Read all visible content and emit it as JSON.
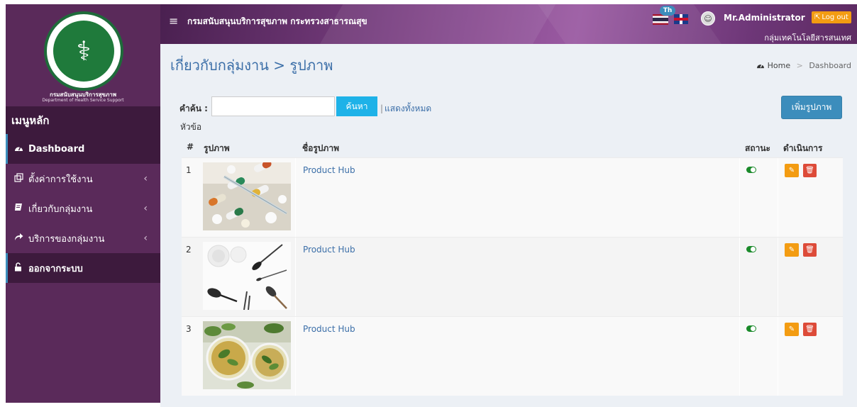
{
  "sidebar": {
    "logo_text": "⚕",
    "logo_caption_1": "กรมสนับสนุนบริการสุขภาพ",
    "logo_caption_2": "Department of Health Service Support",
    "menu_header": "เมนูหลัก",
    "items": [
      {
        "label": "Dashboard",
        "icon": "dashboard-icon"
      },
      {
        "label": "ตั้งค่าการใช้งาน",
        "icon": "clone-icon"
      },
      {
        "label": "เกี่ยวกับกลุ่มงาน",
        "icon": "book-icon"
      },
      {
        "label": "บริการของกลุ่มงาน",
        "icon": "share-arrow-icon"
      },
      {
        "label": "ออกจากระบบ",
        "icon": "lock-icon"
      }
    ]
  },
  "header": {
    "site_title": "กรมสนับสนุนบริการสุขภาพ กระทรวงสาธารณสุข",
    "lang_badge": "Th",
    "user_name": "Mr.Administrator",
    "logout_label": "Log out",
    "dept_name": "กลุ่มเทคโนโลยีสารสนเทศ"
  },
  "page": {
    "title": "เกี่ยวกับกลุ่มงาน > รูปภาพ",
    "breadcrumb_home": "Home",
    "breadcrumb_sep": ">",
    "breadcrumb_current": "Dashboard"
  },
  "search": {
    "label": "คำค้น :",
    "value": "",
    "placeholder": "",
    "button": "ค้นหา",
    "show_all_sep": "|",
    "show_all": "แสดงทั้งหมด",
    "topic_label": "หัวข้อ"
  },
  "add_button": "เพิ่มรูปภาพ",
  "table": {
    "headers": {
      "num": "#",
      "image": "รูปภาพ",
      "name": "ชื่อรูปภาพ",
      "status": "สถานะ",
      "action": "ดำเนินการ"
    },
    "rows": [
      {
        "num": "1",
        "name": "Product Hub",
        "image": "pills-photo"
      },
      {
        "num": "2",
        "name": "Product Hub",
        "image": "makeup-brushes-photo"
      },
      {
        "num": "3",
        "name": "Product Hub",
        "image": "herbal-tea-photo"
      }
    ]
  },
  "colors": {
    "sidebar": "#5a2a5a",
    "sidebar_active": "#3d1a3d",
    "accent_blue": "#3c8dbc",
    "search_btn": "#1eb2e8",
    "edit": "#f39c12",
    "delete": "#dd4b39",
    "status_on": "#1a8a2a"
  }
}
